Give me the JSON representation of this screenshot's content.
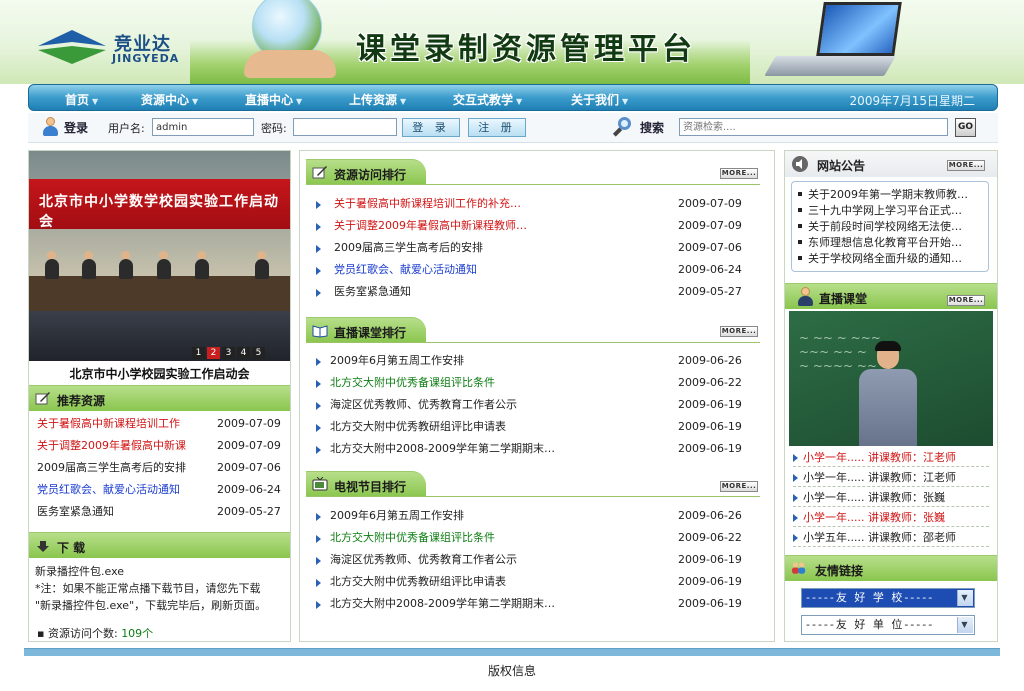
{
  "brand": {
    "name_cn": "竞业达",
    "name_en": "JINGYEDA",
    "site_title": "课堂录制资源管理平台"
  },
  "nav": {
    "items": [
      {
        "label": "首页"
      },
      {
        "label": "资源中心"
      },
      {
        "label": "直播中心"
      },
      {
        "label": "上传资源"
      },
      {
        "label": "交互式教学"
      },
      {
        "label": "关于我们"
      }
    ],
    "date": "2009年7月15日星期二"
  },
  "login": {
    "title": "登录",
    "username_label": "用户名:",
    "username_value": "admin",
    "password_label": "密码:",
    "login_button": "登 录",
    "register_button": "注 册",
    "search_title": "搜索",
    "search_placeholder": "资源检索....",
    "go_button": "GO"
  },
  "slideshow": {
    "banner_text": "北京市中小学数学校园实验工作启动会",
    "caption": "北京市中小学校园实验工作启动会",
    "pages": [
      "1",
      "2",
      "3",
      "4",
      "5"
    ],
    "active_page": "2"
  },
  "recommended": {
    "title": "推荐资源",
    "items": [
      {
        "title": "关于暑假高中新课程培训工作",
        "date": "2009-07-09",
        "color": "red"
      },
      {
        "title": "关于调整2009年暑假高中新课",
        "date": "2009-07-09",
        "color": "red"
      },
      {
        "title": "2009届高三学生高考后的安排",
        "date": "2009-07-06",
        "color": "dark"
      },
      {
        "title": "党员红歌会、献爱心活动通知",
        "date": "2009-06-24",
        "color": "blue"
      },
      {
        "title": "医务室紧急通知",
        "date": "2009-05-27",
        "color": "dark"
      }
    ]
  },
  "download": {
    "title": "下 载",
    "line1": "新录播控件包.exe",
    "line2": "*注：如果不能正常点播下载节目，请您先下载",
    "line3": "\"新录播控件包.exe\"，下载完毕后，刷新页面。",
    "stat_label": "资源访问个数:",
    "stat_value": "109个"
  },
  "more_label": "MORE...",
  "ranking": {
    "title": "资源访问排行",
    "items": [
      {
        "title": "关于暑假高中新课程培训工作的补充…",
        "date": "2009-07-09",
        "color": "red"
      },
      {
        "title": "关于调整2009年暑假高中新课程教师…",
        "date": "2009-07-09",
        "color": "red"
      },
      {
        "title": "2009届高三学生高考后的安排",
        "date": "2009-07-06",
        "color": "dark"
      },
      {
        "title": "党员红歌会、献爱心活动通知",
        "date": "2009-06-24",
        "color": "blue"
      },
      {
        "title": "医务室紧急通知",
        "date": "2009-05-27",
        "color": "dark"
      }
    ]
  },
  "live_ranking": {
    "title": "直播课堂排行",
    "items": [
      {
        "title": "2009年6月第五周工作安排",
        "date": "2009-06-26",
        "color": "dark"
      },
      {
        "title": "北方交大附中优秀备课组评比条件",
        "date": "2009-06-22",
        "color": "green"
      },
      {
        "title": "海淀区优秀教师、优秀教育工作者公示",
        "date": "2009-06-19",
        "color": "dark"
      },
      {
        "title": "北方交大附中优秀教研组评比申请表",
        "date": "2009-06-19",
        "color": "dark"
      },
      {
        "title": "北方交大附中2008-2009学年第二学期期末…",
        "date": "2009-06-19",
        "color": "dark"
      }
    ]
  },
  "tv_ranking": {
    "title": "电视节目排行",
    "items": [
      {
        "title": "2009年6月第五周工作安排",
        "date": "2009-06-26",
        "color": "dark"
      },
      {
        "title": "北方交大附中优秀备课组评比条件",
        "date": "2009-06-22",
        "color": "green"
      },
      {
        "title": "海淀区优秀教师、优秀教育工作者公示",
        "date": "2009-06-19",
        "color": "dark"
      },
      {
        "title": "北方交大附中优秀教研组评比申请表",
        "date": "2009-06-19",
        "color": "dark"
      },
      {
        "title": "北方交大附中2008-2009学年第二学期期末…",
        "date": "2009-06-19",
        "color": "dark"
      }
    ]
  },
  "notice": {
    "title": "网站公告",
    "items": [
      "关于2009年第一学期末教师教…",
      "三十九中学网上学习平台正式…",
      "关于前段时间学校网络无法使…",
      "东师理想信息化教育平台开始…",
      "关于学校网络全面升级的通知…"
    ]
  },
  "live_class": {
    "title": "直播课堂",
    "items": [
      {
        "course": "小学一年.....",
        "teacher": "讲课教师：江老师",
        "color": "red"
      },
      {
        "course": "小学一年.....",
        "teacher": "讲课教师：江老师",
        "color": "dark"
      },
      {
        "course": "小学一年.....",
        "teacher": "讲课教师：张巍",
        "color": "dark"
      },
      {
        "course": "小学一年.....",
        "teacher": "讲课教师：张巍",
        "color": "red"
      },
      {
        "course": "小学五年.....",
        "teacher": "讲课教师：邵老师",
        "color": "dark"
      }
    ]
  },
  "links": {
    "title": "友情链接",
    "select1": "-----友 好 学 校-----",
    "select2": "-----友 好 单 位-----"
  },
  "footer": {
    "copyright": "版权信息"
  },
  "colors": {
    "nav_blue": "#1f7fb4",
    "section_green": "#8ac64e",
    "red_link": "#d11515",
    "blue_link": "#1a3ccf",
    "green_link": "#0d7d12"
  }
}
